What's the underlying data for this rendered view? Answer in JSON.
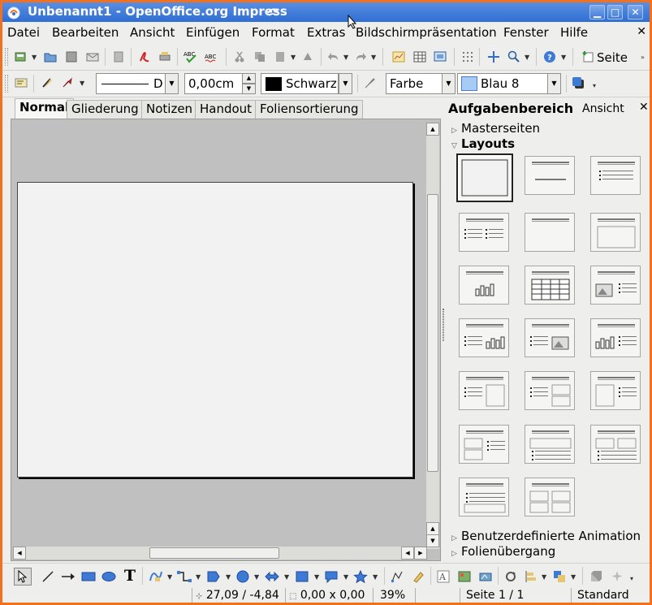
{
  "window": {
    "title": "Unbenannt1 - OpenOffice.org Impress",
    "controls": {
      "minimize": "▁",
      "maximize": "□",
      "close": "✕"
    }
  },
  "menubar": {
    "items": [
      "Datei",
      "Bearbeiten",
      "Ansicht",
      "Einfügen",
      "Format",
      "Extras",
      "Bildschirmpräsentation",
      "Fenster",
      "Hilfe"
    ],
    "close": "✕"
  },
  "toolbar1": {
    "seite_label": "Seite"
  },
  "toolbar2": {
    "line_style": "D",
    "line_width": "0,00cm",
    "line_color": "Schwarz",
    "line_color_hex": "#000000",
    "area_style": "Farbe",
    "area_color": "Blau 8",
    "area_color_hex": "#a6cbf5"
  },
  "tabs": [
    "Normal",
    "Gliederung",
    "Notizen",
    "Handout",
    "Foliensortierung"
  ],
  "taskpane": {
    "title": "Aufgabenbereich",
    "view_label": "Ansicht",
    "close": "✕",
    "sections": {
      "master_pages": "Masterseiten",
      "layouts": "Layouts",
      "custom_animation": "Benutzerdefinierte Animation",
      "slide_transition": "Folienübergang"
    }
  },
  "statusbar": {
    "position": "27,09 / -4,84",
    "size": "0,00 x 0,00",
    "zoom": "39%",
    "page": "Seite 1 / 1",
    "master": "Standard"
  },
  "colors": {
    "titlebar": "#2f6ed3",
    "desktop_border": "#f3701e"
  }
}
